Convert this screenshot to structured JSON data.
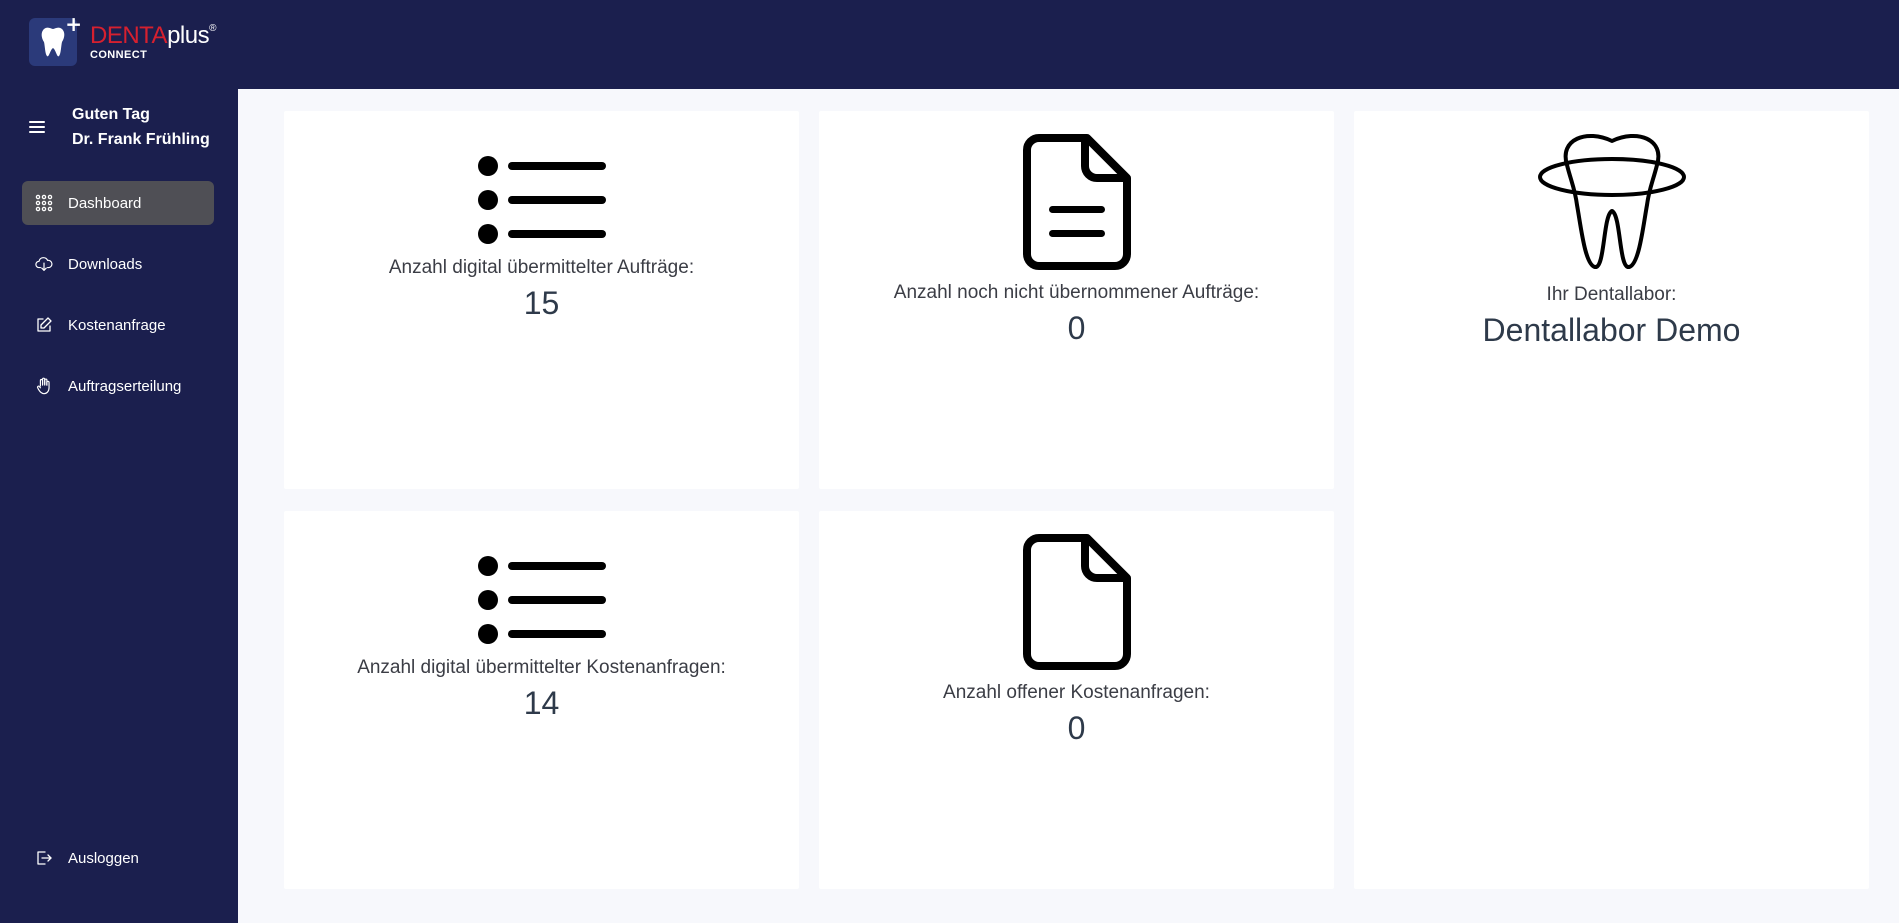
{
  "header": {
    "logo": {
      "brand_red": "DENTA",
      "brand_white": "plus",
      "registered": "®",
      "sub": "CONNECT"
    }
  },
  "sidebar": {
    "greeting_line1": "Guten Tag",
    "greeting_line2": "Dr. Frank Frühling",
    "items": [
      {
        "label": "Dashboard",
        "icon": "grid-icon",
        "active": true
      },
      {
        "label": "Downloads",
        "icon": "cloud-download-icon",
        "active": false
      },
      {
        "label": "Kostenanfrage",
        "icon": "edit-icon",
        "active": false
      },
      {
        "label": "Auftragserteilung",
        "icon": "hand-icon",
        "active": false
      }
    ],
    "logout_label": "Ausloggen"
  },
  "dashboard": {
    "cards": [
      {
        "label": "Anzahl digital übermittelter Aufträge:",
        "value": "15",
        "icon": "list-icon"
      },
      {
        "label": "Anzahl noch nicht übernommener Aufträge:",
        "value": "0",
        "icon": "document-text-icon"
      },
      {
        "label": "Ihr Dentallabor:",
        "value": "Dentallabor Demo",
        "icon": "tooth-icon"
      },
      {
        "label": "Anzahl digital übermittelter Kostenanfragen:",
        "value": "14",
        "icon": "list-icon"
      },
      {
        "label": "Anzahl offener Kostenanfragen:",
        "value": "0",
        "icon": "document-icon"
      }
    ]
  },
  "colors": {
    "sidebar_bg": "#1b1f4e",
    "brand_red": "#d6202f",
    "active_item_bg": "#4f4f55",
    "content_bg": "#f7f8fc",
    "card_bg": "#ffffff"
  }
}
